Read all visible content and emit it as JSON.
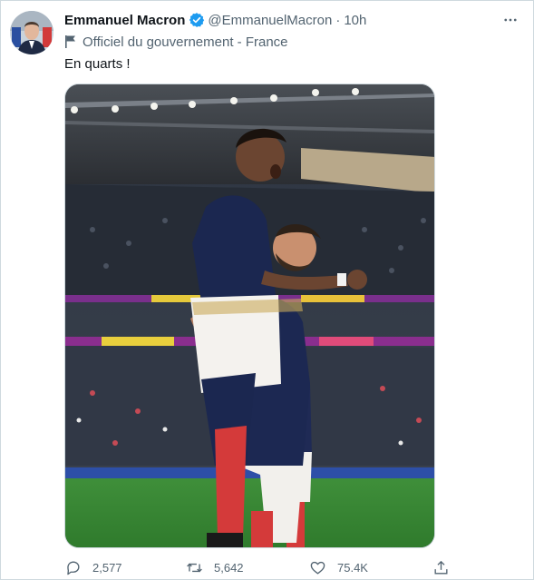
{
  "tweet": {
    "author_name": "Emmanuel Macron",
    "handle": "@EmmanuelMacron",
    "separator": "·",
    "time": "10h",
    "account_label": "Officiel du gouvernement - France",
    "text": "En quarts !",
    "verified_icon": "verified-badge-icon",
    "label_icon": "flag-icon"
  },
  "actions": {
    "replies": "2,577",
    "retweets": "5,642",
    "likes": "75.4K",
    "icons": [
      "reply-icon",
      "retweet-icon",
      "like-icon",
      "share-icon"
    ]
  },
  "colors": {
    "accent": "#1d9bf0",
    "text_primary": "#0f1419",
    "text_secondary": "#536471",
    "border": "#cfd9de"
  }
}
